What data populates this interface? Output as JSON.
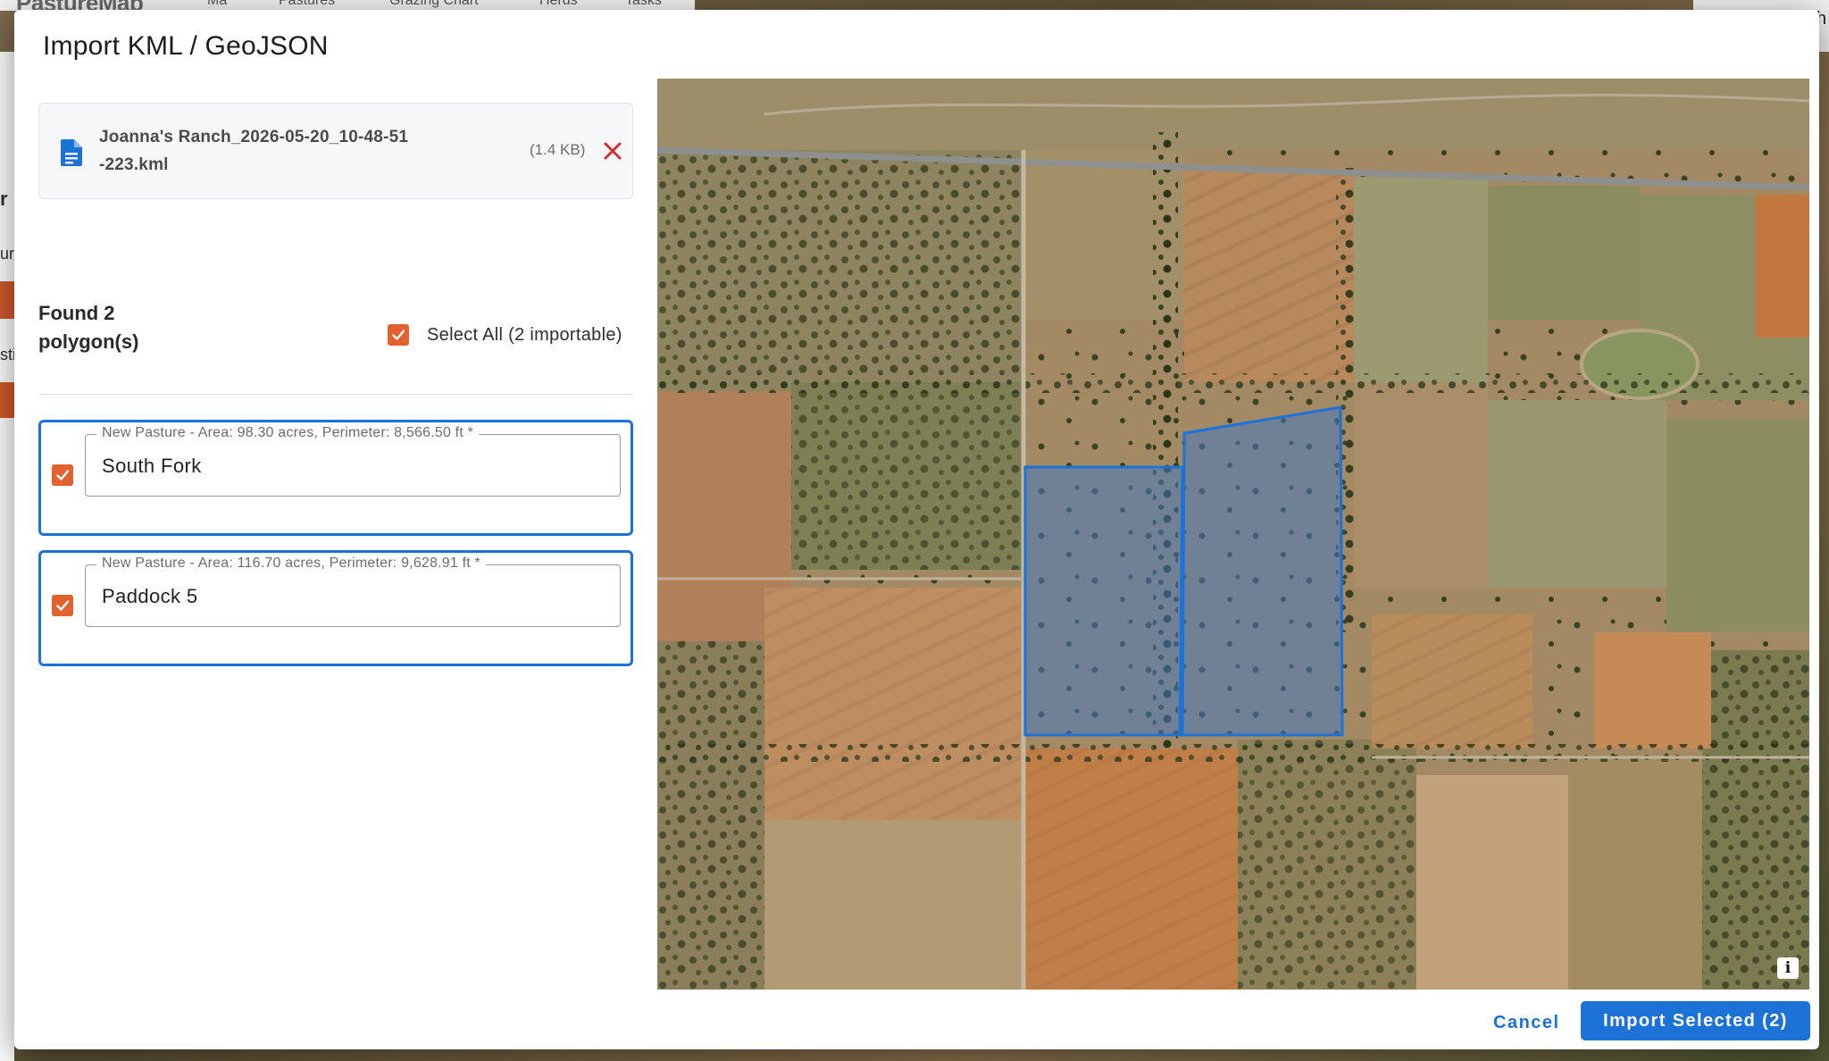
{
  "background_app": {
    "logo_fragment": "PastureMap",
    "nav_fragments": [
      "Ma",
      "Pastures",
      "Grazing Chart",
      "Herds",
      "Tasks"
    ],
    "right_fragment": "h",
    "left_fragments": [
      "r",
      "ur",
      "sti"
    ]
  },
  "dialog": {
    "title": "Import KML / GeoJSON"
  },
  "file": {
    "name": "Joanna's Ranch_2026-05-20_10-48-51-223.kml",
    "size": "(1.4 KB)",
    "icon": "file-document-icon",
    "remove_icon": "close-icon"
  },
  "found": {
    "text": "Found 2 polygon(s)",
    "select_all_label": "Select All (2 importable)",
    "select_all_checked": true
  },
  "polygons": [
    {
      "legend": "New Pasture - Area: 98.30 acres, Perimeter: 8,566.50 ft *",
      "name": "South Fork",
      "checked": true
    },
    {
      "legend": "New Pasture - Area: 116.70 acres, Perimeter: 9,628.91 ft *",
      "name": "Paddock 5",
      "checked": true
    }
  ],
  "map": {
    "info_label": "i",
    "highlight_color": "#1d72d8"
  },
  "actions": {
    "cancel_label": "Cancel",
    "import_label": "Import Selected (2)"
  },
  "colors": {
    "accent": "#1d72d8",
    "checkbox": "#e2622f",
    "remove": "#d32f2f"
  }
}
